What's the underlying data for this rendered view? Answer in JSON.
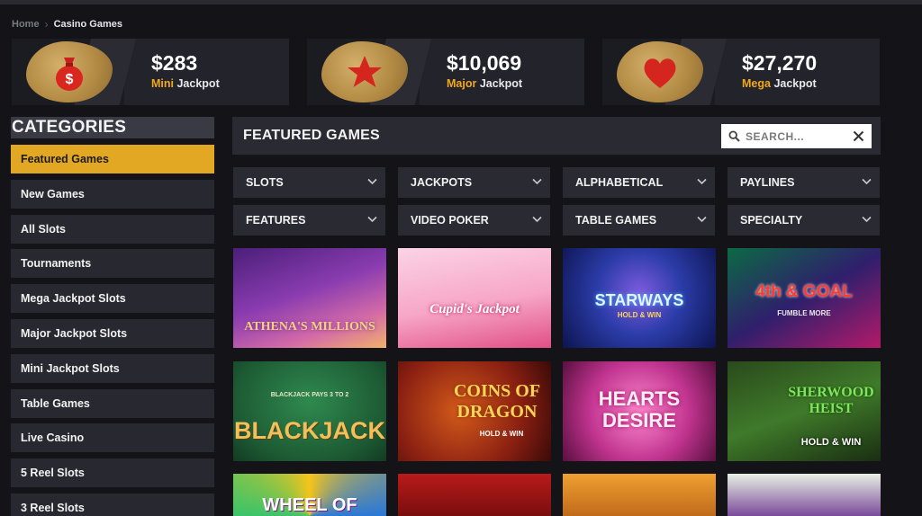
{
  "breadcrumb": {
    "home": "Home",
    "current": "Casino Games"
  },
  "jackpots": [
    {
      "amount": "$283",
      "tier": "Mini",
      "label": "Jackpot",
      "icon": "money-bag-icon"
    },
    {
      "amount": "$10,069",
      "tier": "Major",
      "label": "Jackpot",
      "icon": "star-icon"
    },
    {
      "amount": "$27,270",
      "tier": "Mega",
      "label": "Jackpot",
      "icon": "heart-icon"
    }
  ],
  "sidebar": {
    "title": "CATEGORIES",
    "items": [
      {
        "label": "Featured Games",
        "active": true
      },
      {
        "label": "New Games"
      },
      {
        "label": "All Slots"
      },
      {
        "label": "Tournaments"
      },
      {
        "label": "Mega Jackpot Slots"
      },
      {
        "label": "Major Jackpot Slots"
      },
      {
        "label": "Mini Jackpot Slots"
      },
      {
        "label": "Table Games"
      },
      {
        "label": "Live Casino"
      },
      {
        "label": "5 Reel Slots"
      },
      {
        "label": "3 Reel Slots"
      }
    ]
  },
  "main": {
    "title": "FEATURED GAMES",
    "search": {
      "placeholder": "SEARCH..."
    },
    "filters": [
      "SLOTS",
      "JACKPOTS",
      "ALPHABETICAL",
      "PAYLINES",
      "FEATURES",
      "VIDEO POKER",
      "TABLE GAMES",
      "SPECIALTY"
    ],
    "games": [
      {
        "title": "ATHENA'S MILLIONS"
      },
      {
        "title": "Cupid's Jackpot"
      },
      {
        "title": "STARWAYS",
        "sub": "HOLD & WIN"
      },
      {
        "title": "4th & GOAL",
        "sub": "FUMBLE MORE"
      },
      {
        "title": "BLACKJACK",
        "sub": "BLACKJACK PAYS 3 TO 2"
      },
      {
        "title": "COINS OF DRAGON",
        "sub": "HOLD & WIN"
      },
      {
        "title": "HEARTS DESIRE"
      },
      {
        "title": "SHERWOOD HEIST",
        "sub": "HOLD & WIN"
      },
      {
        "title": "WHEEL OF"
      },
      {
        "title": ""
      },
      {
        "title": ""
      },
      {
        "title": ""
      }
    ]
  },
  "colors": {
    "accent": "#e3a823",
    "tier": "#f0a81f",
    "panel": "#2a2a32",
    "background": "#131318"
  }
}
